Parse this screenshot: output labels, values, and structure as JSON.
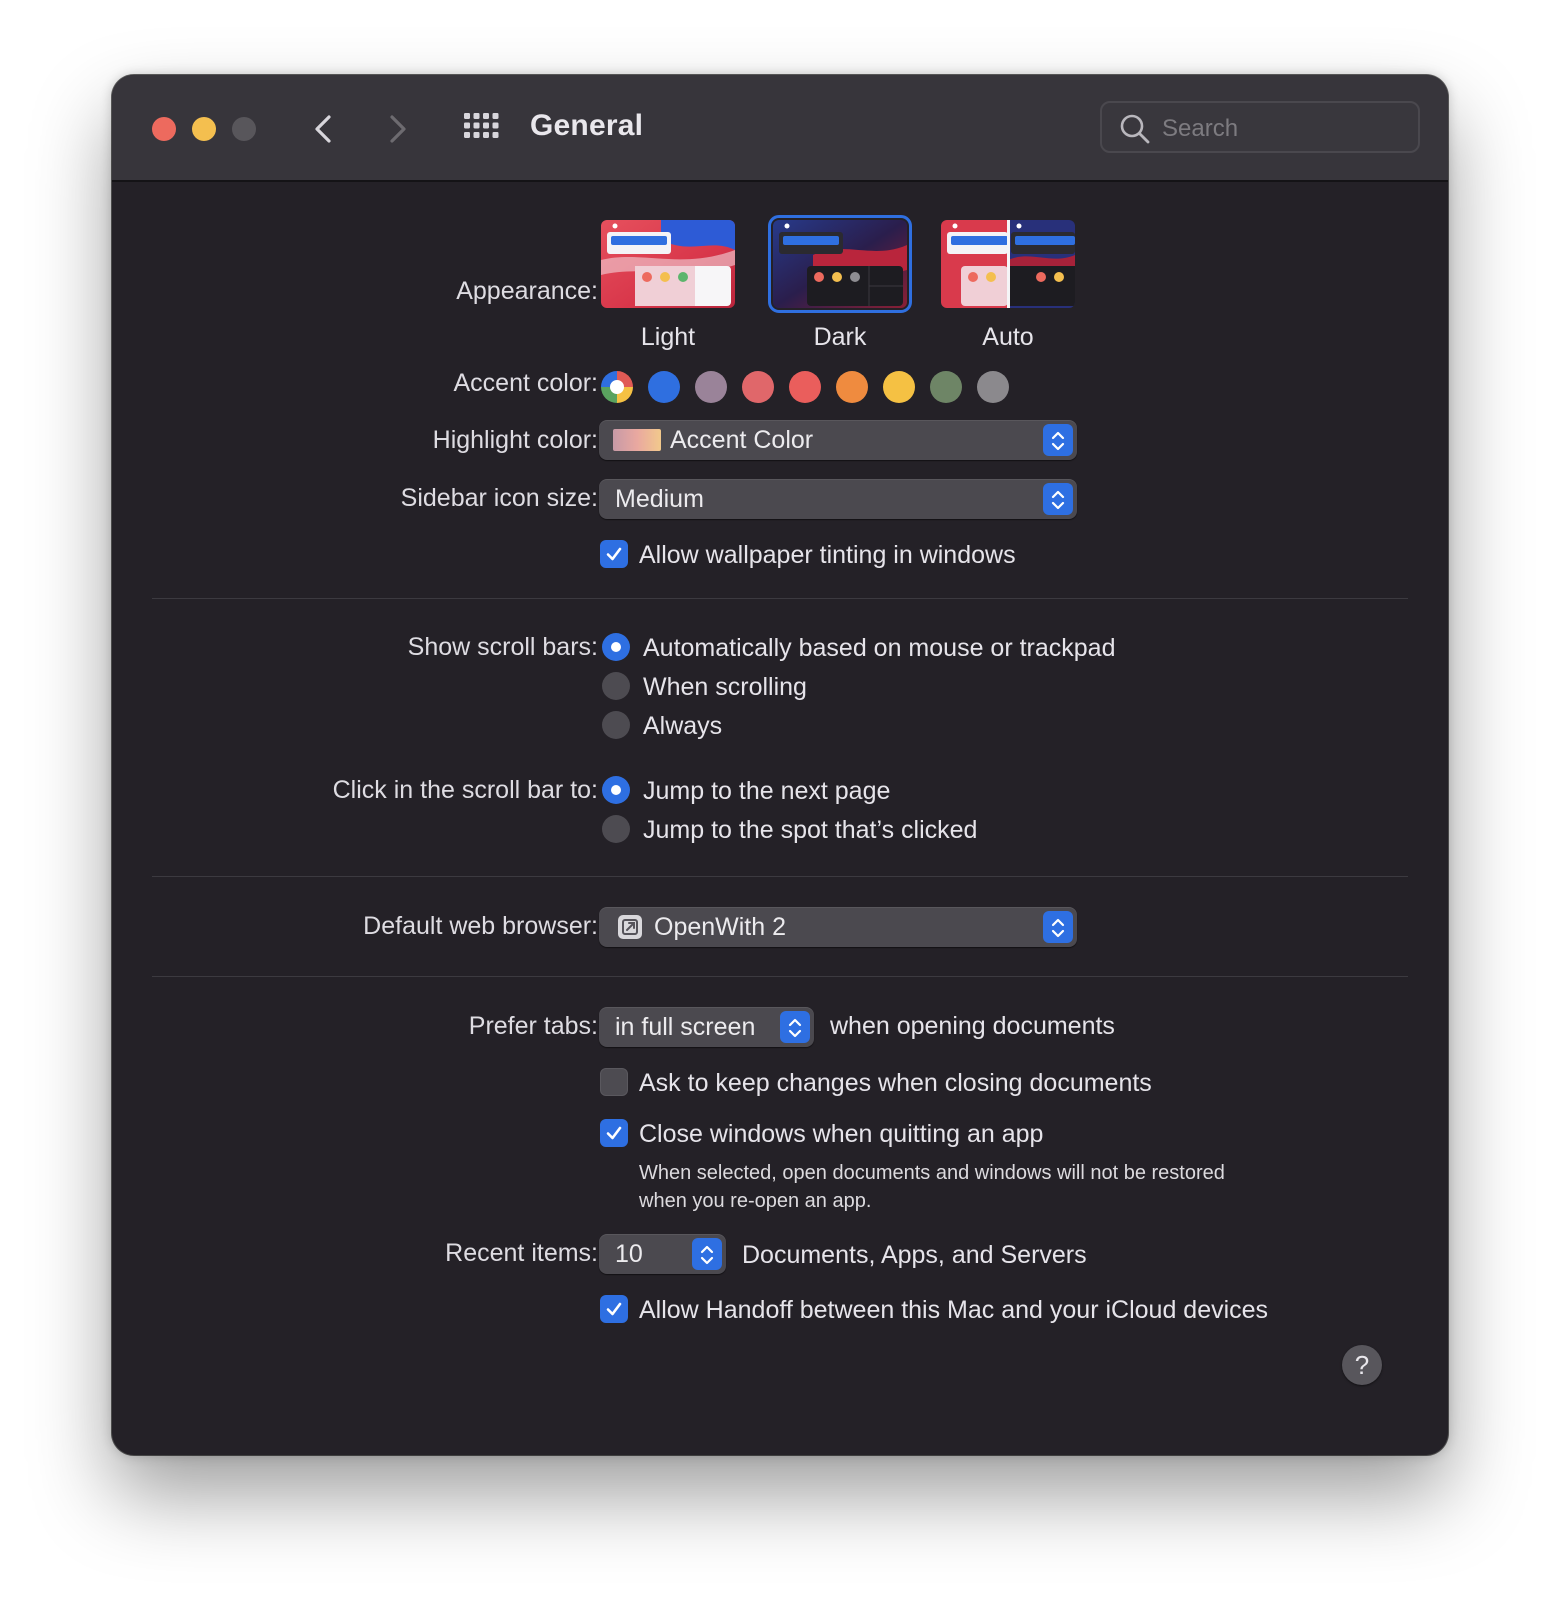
{
  "window": {
    "title": "General"
  },
  "toolbar": {
    "search_placeholder": "Search"
  },
  "appearance": {
    "label": "Appearance:",
    "options": [
      "Light",
      "Dark",
      "Auto"
    ],
    "selected": "Dark"
  },
  "accent": {
    "label": "Accent color:",
    "colors": [
      "#d9d9d9",
      "#2f6fe0",
      "#9a8399",
      "#e0676a",
      "#ea5e5c",
      "#ef8b3f",
      "#f5c143",
      "#6e8566",
      "#8b898d"
    ]
  },
  "highlight": {
    "label": "Highlight color:",
    "value": "Accent Color"
  },
  "sidebar_icon": {
    "label": "Sidebar icon size:",
    "value": "Medium"
  },
  "wallpaper_tinting": {
    "label": "Allow wallpaper tinting in windows",
    "checked": true
  },
  "scroll_bars": {
    "label": "Show scroll bars:",
    "options": [
      "Automatically based on mouse or trackpad",
      "When scrolling",
      "Always"
    ],
    "selected": 0
  },
  "scroll_click": {
    "label": "Click in the scroll bar to:",
    "options": [
      "Jump to the next page",
      "Jump to the spot that’s clicked"
    ],
    "selected": 0
  },
  "browser": {
    "label": "Default web browser:",
    "value": "OpenWith 2"
  },
  "tabs": {
    "label": "Prefer tabs:",
    "value": "in full screen",
    "suffix": "when opening documents"
  },
  "ask_keep": {
    "label": "Ask to keep changes when closing documents",
    "checked": false
  },
  "close_windows": {
    "label": "Close windows when quitting an app",
    "checked": true,
    "note_line1": "When selected, open documents and windows will not be restored",
    "note_line2": "when you re-open an app."
  },
  "recent": {
    "label": "Recent items:",
    "value": "10",
    "suffix": "Documents, Apps, and Servers"
  },
  "handoff": {
    "label": "Allow Handoff between this Mac and your iCloud devices",
    "checked": true
  },
  "help": {
    "glyph": "?"
  }
}
